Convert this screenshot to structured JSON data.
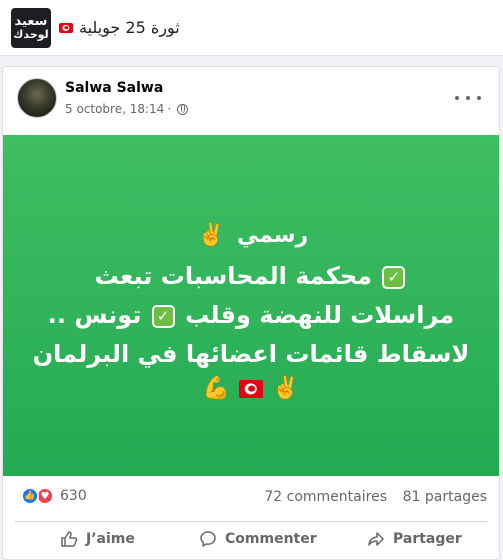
{
  "group": {
    "logo_line1": "سعيد",
    "logo_line2": "لوحدك",
    "title": "ثورة 25 جويلية"
  },
  "post": {
    "author": "Salwa Salwa",
    "timestamp": "5 octobre, 18:14",
    "lines": [
      "رسمي",
      "محكمة المحاسبات تبعث",
      "مراسلات للنهضة وقلب",
      "تونس ..",
      "لاسقاط قائمات اعضائها في البرلمان"
    ]
  },
  "stats": {
    "reaction_count": "630",
    "comments": "72 commentaires",
    "shares": "81 partages"
  },
  "actions": {
    "like": "J’aime",
    "comment": "Commenter",
    "share": "Partager"
  },
  "colors": {
    "post_background": "#2fb459",
    "like_blue": "#1877f2",
    "love_red": "#f33e58",
    "tunisia_red": "#e70013"
  }
}
